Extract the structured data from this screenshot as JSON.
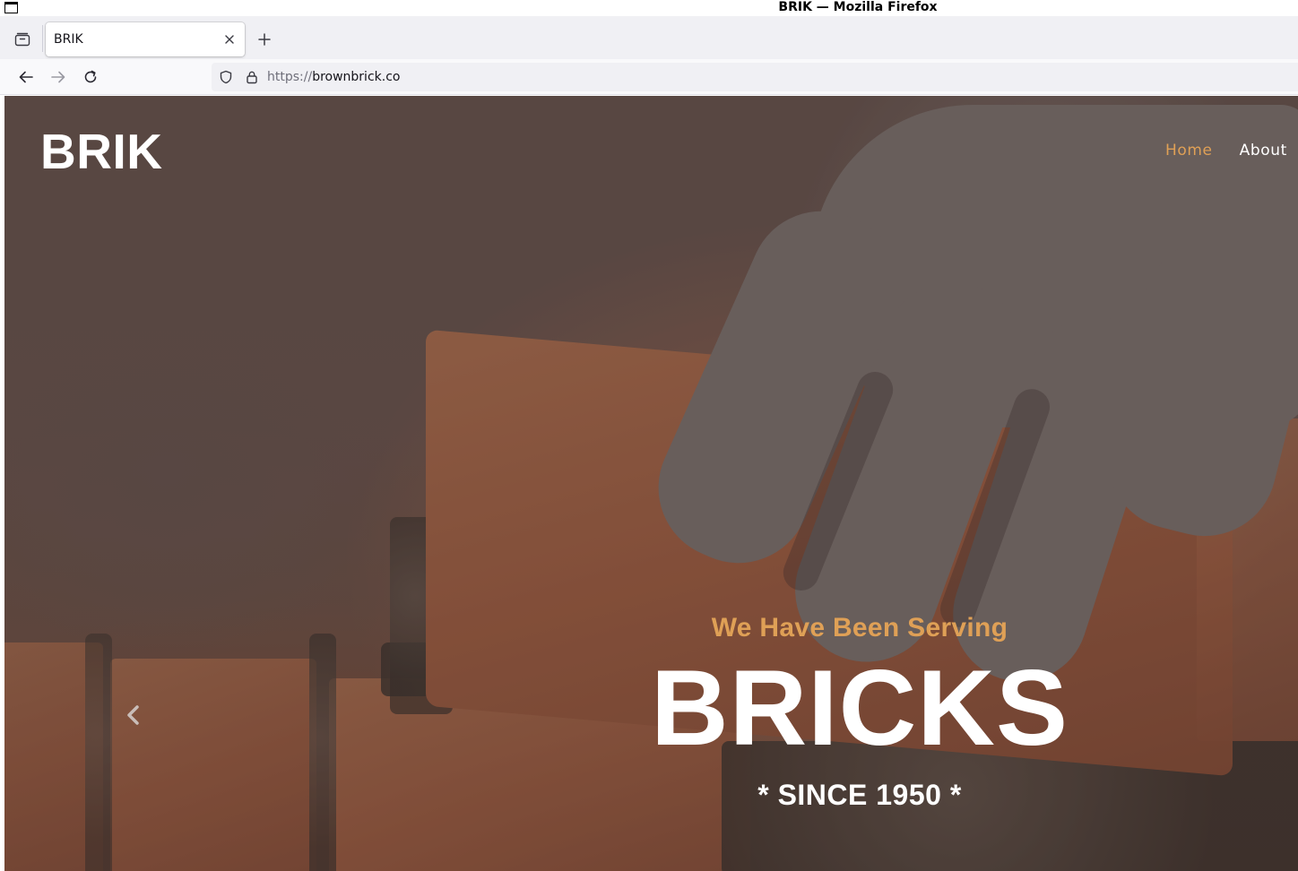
{
  "window": {
    "title": "BRIK — Mozilla Firefox"
  },
  "tabs": [
    {
      "title": "BRIK",
      "active": true
    }
  ],
  "urlbar": {
    "scheme": "https://",
    "host": "brownbrick.co"
  },
  "page": {
    "logo": "BRIK",
    "menu": [
      {
        "label": "Home",
        "active": true
      },
      {
        "label": "About",
        "active": false
      }
    ],
    "hero": {
      "subtitle": "We Have Been Serving",
      "title": "BRICKS",
      "since": "* SINCE 1950 *"
    },
    "colors": {
      "accent": "#dfa056",
      "text": "#ffffff"
    }
  },
  "icons": [
    "window-icon",
    "tab-manager-icon",
    "close-icon",
    "plus-icon",
    "back-arrow-icon",
    "forward-arrow-icon",
    "reload-icon",
    "shield-icon",
    "lock-icon",
    "chevron-left-icon"
  ]
}
